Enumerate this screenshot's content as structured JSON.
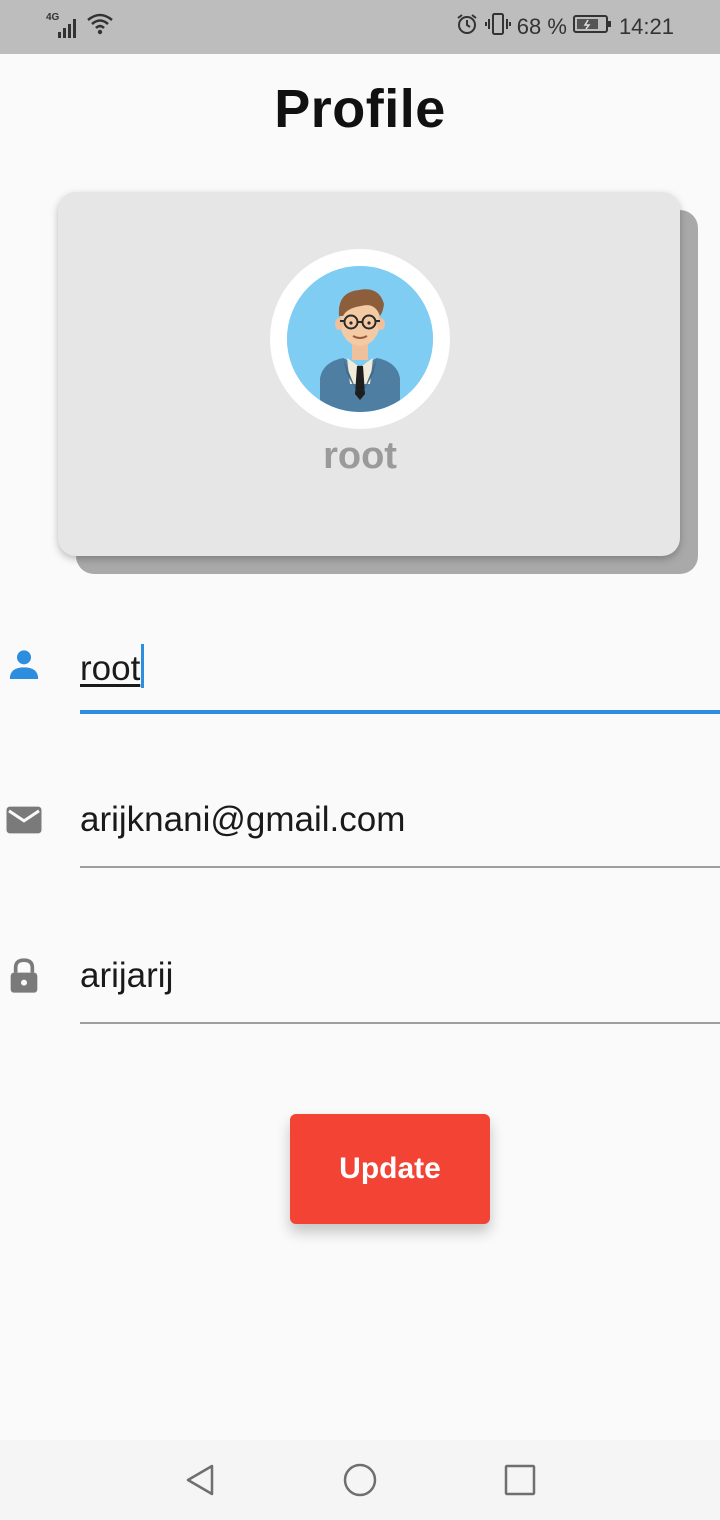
{
  "status_bar": {
    "network": "4G",
    "battery": "68 %",
    "time": "14:21",
    "icons": [
      "signal-icon",
      "wifi-icon",
      "alarm-icon",
      "vibrate-icon",
      "battery-icon"
    ]
  },
  "page": {
    "title": "Profile"
  },
  "profile_card": {
    "name": "root",
    "avatar_icon": "avatar-illustration"
  },
  "form": {
    "username": {
      "value": "root",
      "icon": "person-icon"
    },
    "email": {
      "value": "arijknani@gmail.com",
      "icon": "mail-icon"
    },
    "password": {
      "value": "arijarij",
      "icon": "lock-icon"
    }
  },
  "update_button": {
    "label": "Update"
  },
  "nav_bar": {
    "icons": [
      "back-icon",
      "home-icon",
      "recents-icon"
    ]
  },
  "colors": {
    "accent": "#2d8ee0",
    "button": "#f34335",
    "card": "#e6e6e6",
    "card_shadow": "#a9a9a9"
  }
}
